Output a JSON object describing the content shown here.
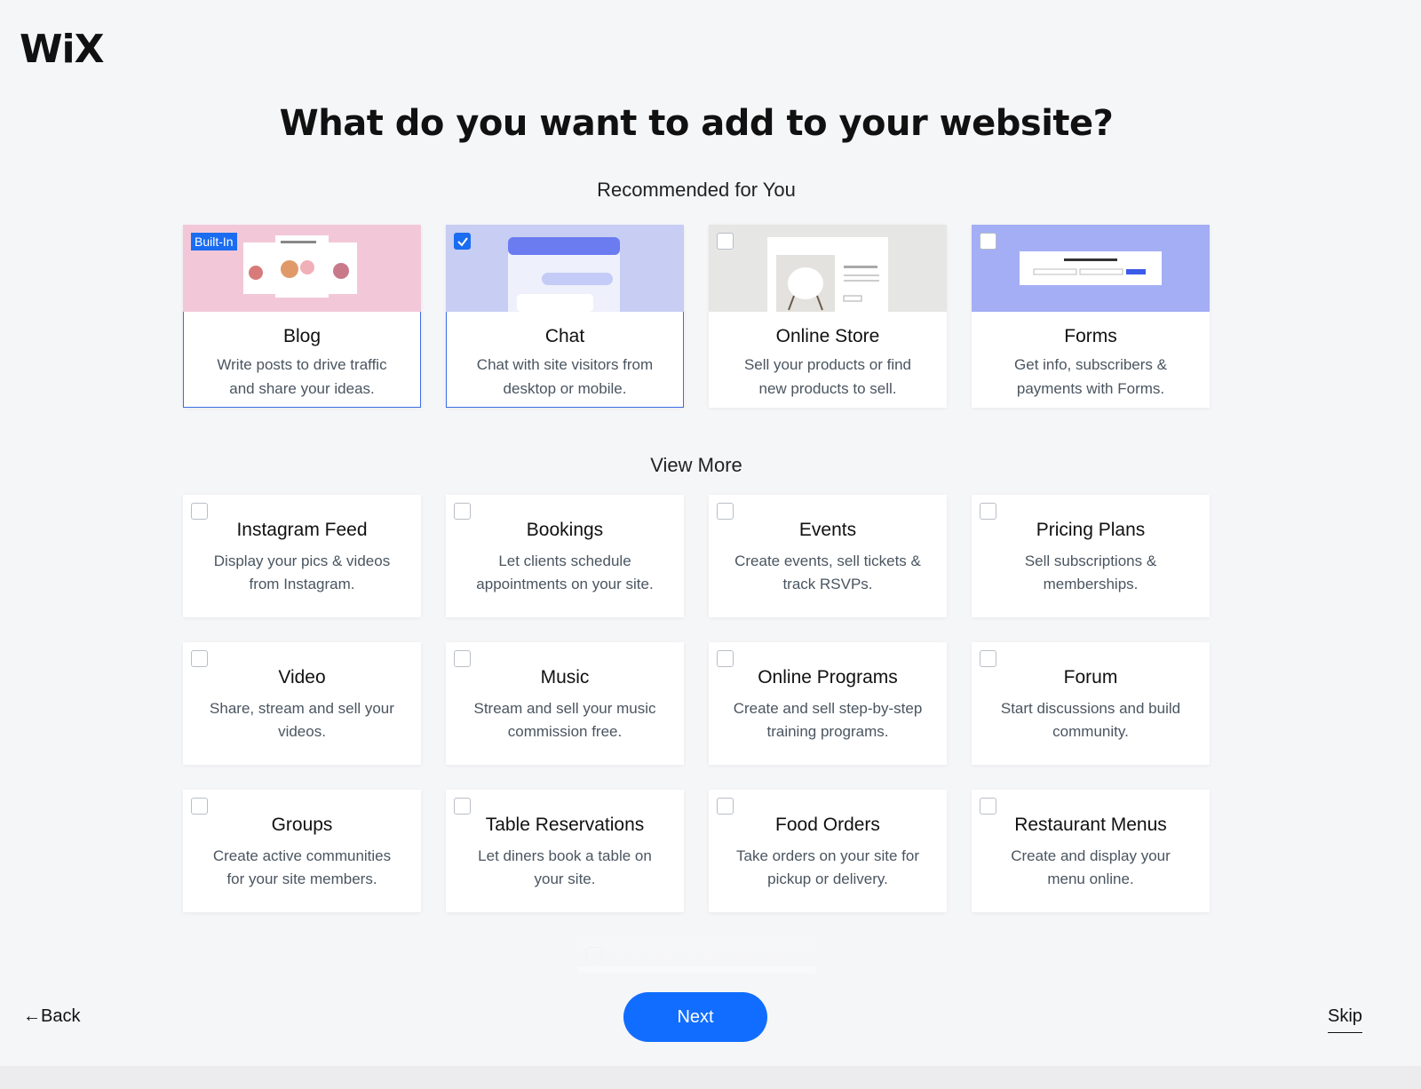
{
  "brand": {
    "logo_text": "WiX"
  },
  "page": {
    "title": "What do you want to add to your website?"
  },
  "recommended": {
    "label": "Recommended for You",
    "cards": [
      {
        "title": "Blog",
        "desc": "Write posts to drive traffic and share your ideas.",
        "badge": "Built-In",
        "checked": false,
        "selected": true
      },
      {
        "title": "Chat",
        "desc": "Chat with site visitors from desktop or mobile.",
        "checked": true,
        "selected": true
      },
      {
        "title": "Online Store",
        "desc": "Sell your products or find new products to sell.",
        "checked": false
      },
      {
        "title": "Forms",
        "desc": "Get info, subscribers & payments with Forms.",
        "checked": false
      }
    ]
  },
  "more": {
    "label": "View More",
    "cards": [
      {
        "title": "Instagram Feed",
        "desc": "Display your pics & videos from Instagram."
      },
      {
        "title": "Bookings",
        "desc": "Let clients schedule appointments on your site."
      },
      {
        "title": "Events",
        "desc": "Create events, sell tickets & track RSVPs."
      },
      {
        "title": "Pricing Plans",
        "desc": "Sell subscriptions & memberships."
      },
      {
        "title": "Video",
        "desc": "Share, stream and sell your videos."
      },
      {
        "title": "Music",
        "desc": "Stream and sell your music commission free."
      },
      {
        "title": "Online Programs",
        "desc": "Create and sell step-by-step training programs."
      },
      {
        "title": "Forum",
        "desc": "Start discussions and build community."
      },
      {
        "title": "Groups",
        "desc": "Create active communities for your site members."
      },
      {
        "title": "Table Reservations",
        "desc": "Let diners book a table on your site."
      },
      {
        "title": "Food Orders",
        "desc": "Take orders on your site for pickup or delivery."
      },
      {
        "title": "Restaurant Menus",
        "desc": "Create and display your menu online."
      }
    ]
  },
  "footer": {
    "back_label": "←Back",
    "next_label": "Next",
    "skip_label": "Skip"
  },
  "colors": {
    "accent": "#116dff",
    "selected_border": "#3b6ee3",
    "background": "#f5f6f8"
  },
  "icons": {
    "check": "check-icon"
  }
}
